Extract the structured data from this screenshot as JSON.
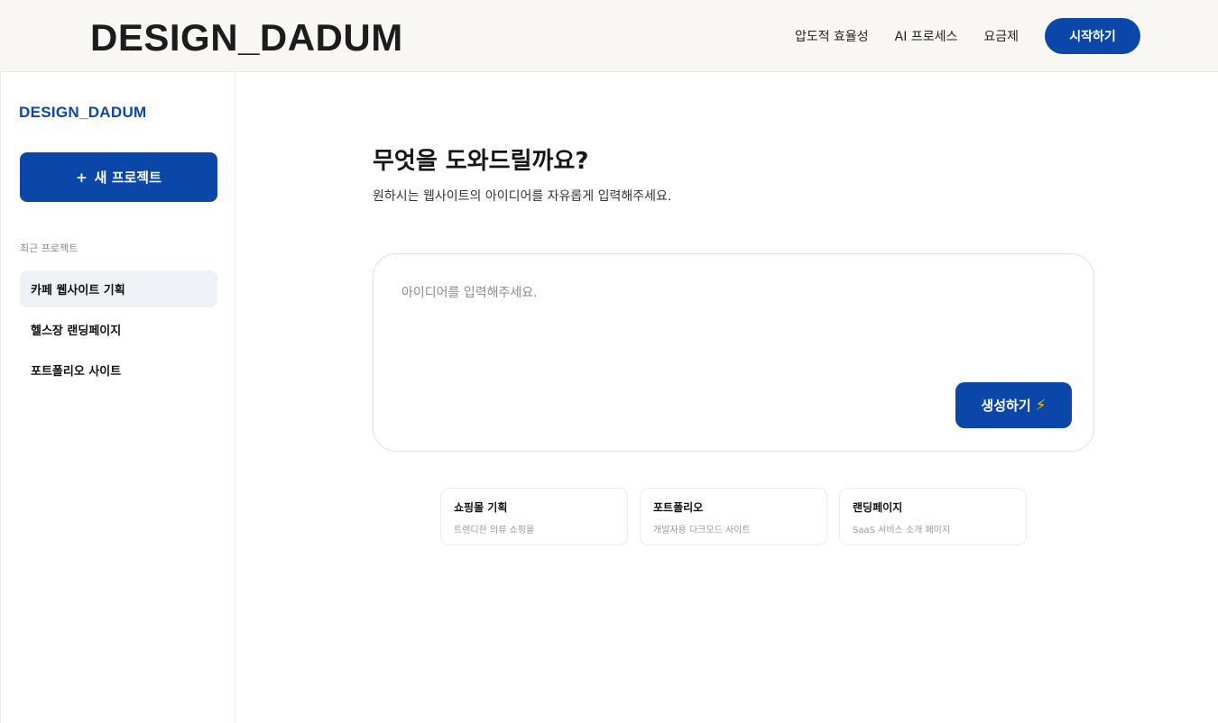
{
  "header": {
    "brand": "DESIGN_DADUM",
    "nav": [
      {
        "label": "압도적 효율성"
      },
      {
        "label": "AI 프로세스"
      },
      {
        "label": "요금제"
      }
    ],
    "cta_label": "시작하기"
  },
  "sidebar": {
    "brand": "DESIGN_DADUM",
    "new_project": {
      "icon": "+",
      "label": "새 프로젝트"
    },
    "recent_label": "최근 프로젝트",
    "recent_items": [
      {
        "label": "카페 웹사이트 기획",
        "active": true
      },
      {
        "label": "헬스장 랜딩페이지",
        "active": false
      },
      {
        "label": "포트폴리오 사이트",
        "active": false
      }
    ]
  },
  "main": {
    "title": "무엇을 도와드릴까요?",
    "subtitle": "원하시는 웹사이트의 아이디어를 자유롭게 입력해주세요.",
    "input_placeholder": "아이디어를 입력해주세요.",
    "input_value": "",
    "generate_label": "생성하기",
    "generate_icon": "⚡",
    "suggestions": [
      {
        "title": "쇼핑몰 기획",
        "desc": "트렌디한 의류 쇼핑몰"
      },
      {
        "title": "포트폴리오",
        "desc": "개발자용 다크모드 사이트"
      },
      {
        "title": "랜딩페이지",
        "desc": "SaaS 서비스 소개 페이지"
      }
    ]
  },
  "colors": {
    "accent": "#0b47a8",
    "header_bg": "#f8f7f3",
    "active_item_bg": "#eef1f6",
    "bolt": "#f6b817"
  }
}
